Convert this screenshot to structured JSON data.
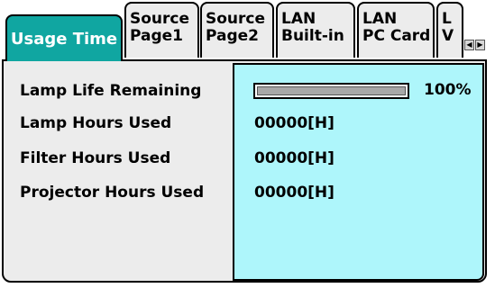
{
  "tabs": [
    {
      "lines": [
        "Usage Time"
      ],
      "active": true
    },
    {
      "lines": [
        "Source",
        "Page1"
      ],
      "active": false
    },
    {
      "lines": [
        "Source",
        "Page2"
      ],
      "active": false
    },
    {
      "lines": [
        "LAN",
        "Built-in"
      ],
      "active": false
    },
    {
      "lines": [
        "LAN",
        "PC Card"
      ],
      "active": false
    },
    {
      "lines": [
        "L",
        "V"
      ],
      "active": false
    }
  ],
  "scroll": {
    "left_glyph": "◀",
    "right_glyph": "▶"
  },
  "rows": [
    {
      "label": "Lamp Life Remaining",
      "value": "100%",
      "progress": 1.0
    },
    {
      "label": "Lamp Hours Used",
      "value": "00000[H]"
    },
    {
      "label": "Filter Hours Used",
      "value": "00000[H]"
    },
    {
      "label": "Projector Hours Used",
      "value": "00000[H]"
    }
  ],
  "colors": {
    "active_tab": "#10a6a1",
    "value_area": "#aef6fb",
    "panel": "#ececec"
  }
}
